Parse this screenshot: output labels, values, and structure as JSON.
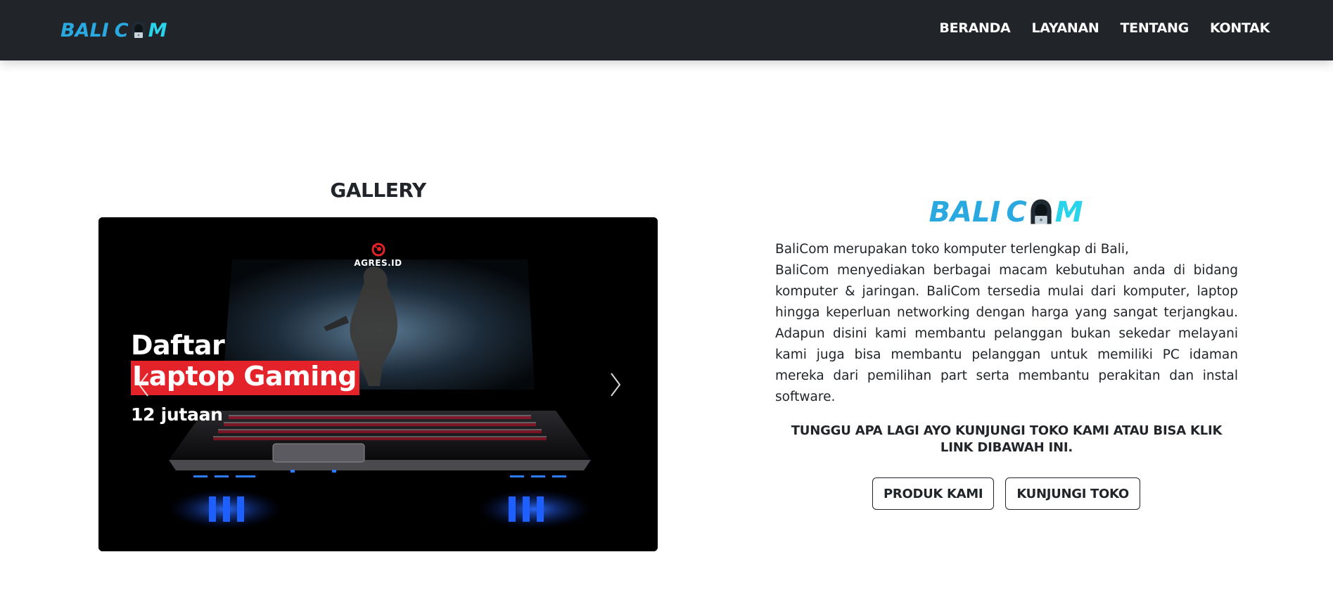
{
  "header": {
    "logo": {
      "part1": "BALI",
      "part2": "C",
      "part3": "M",
      "icon": "hacker-icon"
    },
    "nav": [
      {
        "label": "BERANDA"
      },
      {
        "label": "LAYANAN"
      },
      {
        "label": "TENTANG"
      },
      {
        "label": "KONTAK"
      }
    ]
  },
  "gallery": {
    "title": "GALLERY",
    "slide": {
      "brand": "AGRES.ID",
      "line1": "Daftar",
      "line2": "Laptop Gaming",
      "line3": "12 jutaan"
    },
    "controls": {
      "prev_icon": "chevron-left-icon",
      "next_icon": "chevron-right-icon"
    }
  },
  "about": {
    "logo": {
      "part1": "BALI",
      "part2": "C",
      "part3": "M"
    },
    "description_first": "BaliCom merupakan toko komputer terlengkap di Bali,",
    "description_rest": "BaliCom menyediakan berbagai macam kebutuhan anda di bidang komputer & jaringan. BaliCom tersedia mulai dari komputer, laptop hingga keperluan networking dengan harga yang sangat terjangkau. Adapun disini kami membantu pelanggan bukan sekedar melayani kami juga bisa membantu pelanggan untuk memiliki PC idaman mereka dari pemilihan part serta membantu perakitan dan instal software.",
    "cta": "TUNGGU APA LAGI AYO KUNJUNGI TOKO KAMI ATAU BISA KLIK LINK DIBAWAH INI.",
    "buttons": [
      {
        "label": "PRODUK KAMI"
      },
      {
        "label": "KUNJUNGI TOKO"
      }
    ]
  },
  "colors": {
    "navbar": "#212529",
    "logo_blue": "#29a9e0",
    "logo_cyan": "#29d3ea",
    "caption_red": "#e3222a"
  }
}
